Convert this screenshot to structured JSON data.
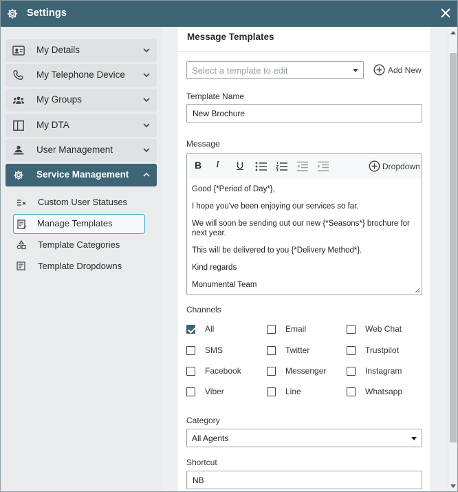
{
  "window": {
    "title": "Settings"
  },
  "sidebar": {
    "items": [
      {
        "label": "My Details",
        "icon": "contact-card-icon",
        "expanded": false
      },
      {
        "label": "My Telephone Device",
        "icon": "phone-icon",
        "expanded": false
      },
      {
        "label": "My Groups",
        "icon": "people-group-icon",
        "expanded": false
      },
      {
        "label": "My DTA",
        "icon": "split-panel-icon",
        "expanded": false
      },
      {
        "label": "User Management",
        "icon": "user-management-icon",
        "expanded": false
      },
      {
        "label": "Service Management",
        "icon": "gear-icon",
        "expanded": true
      }
    ],
    "sub_items": [
      {
        "label": "Custom User Statuses",
        "icon": "status-list-icon"
      },
      {
        "label": "Manage Templates",
        "icon": "edit-template-icon",
        "selected": true
      },
      {
        "label": "Template Categories",
        "icon": "shapes-icon"
      },
      {
        "label": "Template Dropdowns",
        "icon": "dropdown-list-icon"
      }
    ]
  },
  "main": {
    "heading": "Message Templates",
    "template_select": {
      "placeholder": "Select a template to edit"
    },
    "add_new_label": "Add New",
    "template_name": {
      "label": "Template Name",
      "value": "New Brochure"
    },
    "message": {
      "label": "Message",
      "toolbar": {
        "bold": "B",
        "italic": "I",
        "underline": "U",
        "dropdown_label": "Dropdown"
      },
      "lines": [
        "Good {*Period of Day*},",
        "I hope you've been enjoying our services so far.",
        "We will soon be sending out our new {*Seasons*} brochure for next year.",
        "This will be delivered to you {*Delivery Method*}.",
        "Kind regards",
        "Monumental Team"
      ]
    },
    "channels": {
      "label": "Channels",
      "options": [
        {
          "label": "All",
          "checked": true
        },
        {
          "label": "Email",
          "checked": false
        },
        {
          "label": "Web Chat",
          "checked": false
        },
        {
          "label": "SMS",
          "checked": false
        },
        {
          "label": "Twitter",
          "checked": false
        },
        {
          "label": "Trustpilot",
          "checked": false
        },
        {
          "label": "Facebook",
          "checked": false
        },
        {
          "label": "Messenger",
          "checked": false
        },
        {
          "label": "Instagram",
          "checked": false
        },
        {
          "label": "Viber",
          "checked": false
        },
        {
          "label": "Line",
          "checked": false
        },
        {
          "label": "Whatsapp",
          "checked": false
        }
      ]
    },
    "category": {
      "label": "Category",
      "value": "All Agents"
    },
    "shortcut": {
      "label": "Shortcut",
      "value": "NB"
    }
  },
  "colors": {
    "primary": "#3e6576",
    "selected_outline": "#49a9c2",
    "sidebar_item_bg": "#dfe2e5"
  }
}
